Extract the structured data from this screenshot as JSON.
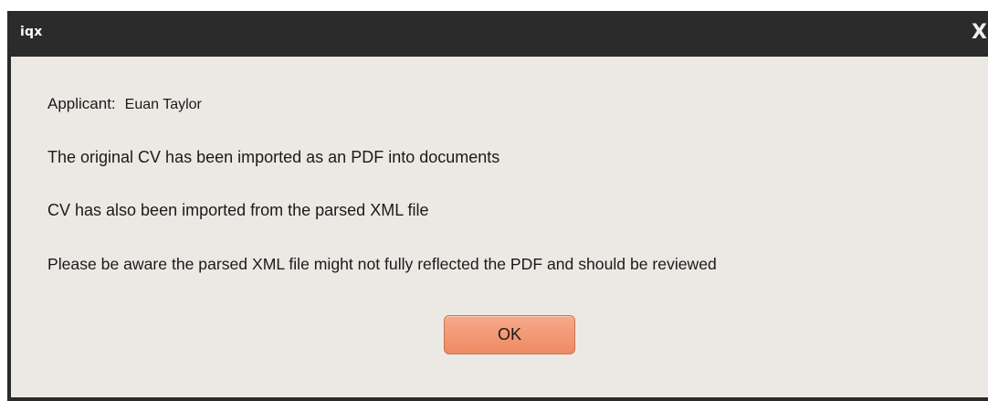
{
  "window": {
    "title": "iqx",
    "close_label": "X"
  },
  "dialog": {
    "applicant_label": "Applicant:",
    "applicant_name": "Euan Taylor",
    "messages": [
      "The original CV has been imported as an PDF into documents",
      "CV has also been imported from the parsed XML file",
      "Please be aware the parsed XML file might not fully reflected the PDF and should be reviewed"
    ],
    "ok_label": "OK"
  },
  "colors": {
    "titlebar": "#2b2b2b",
    "content_background": "#ece9e4",
    "ok_button": "#f39a78"
  }
}
